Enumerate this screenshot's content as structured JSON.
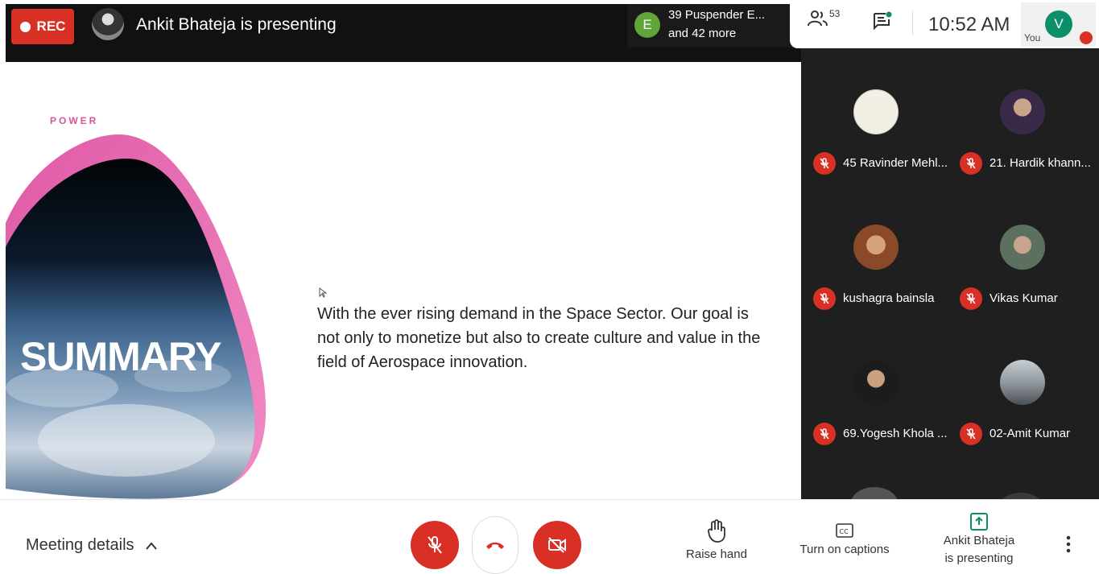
{
  "top": {
    "rec_label": "REC",
    "presenter_title": "Ankit Bhateja is presenting",
    "others_initial": "E",
    "others_line1": "39 Puspender E...",
    "others_line2": "and 42 more"
  },
  "status": {
    "people_count": "53",
    "time": "10:52 AM",
    "you_label": "You",
    "you_initial": "V"
  },
  "slide": {
    "brand": "POWER",
    "heading": "SUMMARY",
    "body": "With the ever rising demand in the Space Sector. Our goal is not only to monetize but also to create culture and value in the field of Aerospace innovation."
  },
  "participants": [
    {
      "name": "45 Ravinder Mehl..."
    },
    {
      "name": "21. Hardik khann..."
    },
    {
      "name": "kushagra bainsla"
    },
    {
      "name": "Vikas Kumar"
    },
    {
      "name": "69.Yogesh Khola ..."
    },
    {
      "name": "02-Amit Kumar"
    }
  ],
  "bottom": {
    "meeting_details": "Meeting details",
    "raise_hand": "Raise hand",
    "captions": "Turn on captions",
    "presenting_line1": "Ankit Bhateja",
    "presenting_line2": "is presenting"
  },
  "colors": {
    "rec_red": "#d93025",
    "others_avatar": "#5fa53a",
    "you_avatar": "#0b8f6b",
    "brand_pink": "#d6559a"
  }
}
